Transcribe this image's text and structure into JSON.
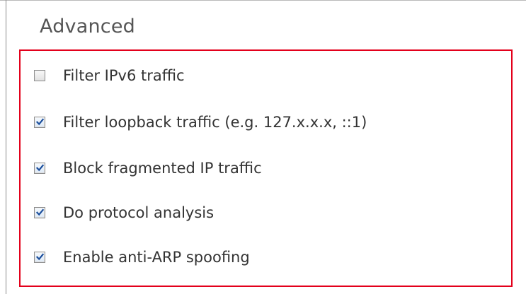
{
  "section": {
    "title": "Advanced"
  },
  "options": [
    {
      "label": "Filter IPv6 traffic",
      "checked": false
    },
    {
      "label": "Filter loopback traffic (e.g. 127.x.x.x, ::1)",
      "checked": true
    },
    {
      "label": "Block fragmented IP traffic",
      "checked": true
    },
    {
      "label": "Do protocol analysis",
      "checked": true
    },
    {
      "label": "Enable anti-ARP spoofing",
      "checked": true
    }
  ],
  "colors": {
    "highlight_border": "#e3001b",
    "checkmark": "#1c4f9c"
  },
  "icons": {
    "checked": "checkmark-icon"
  }
}
